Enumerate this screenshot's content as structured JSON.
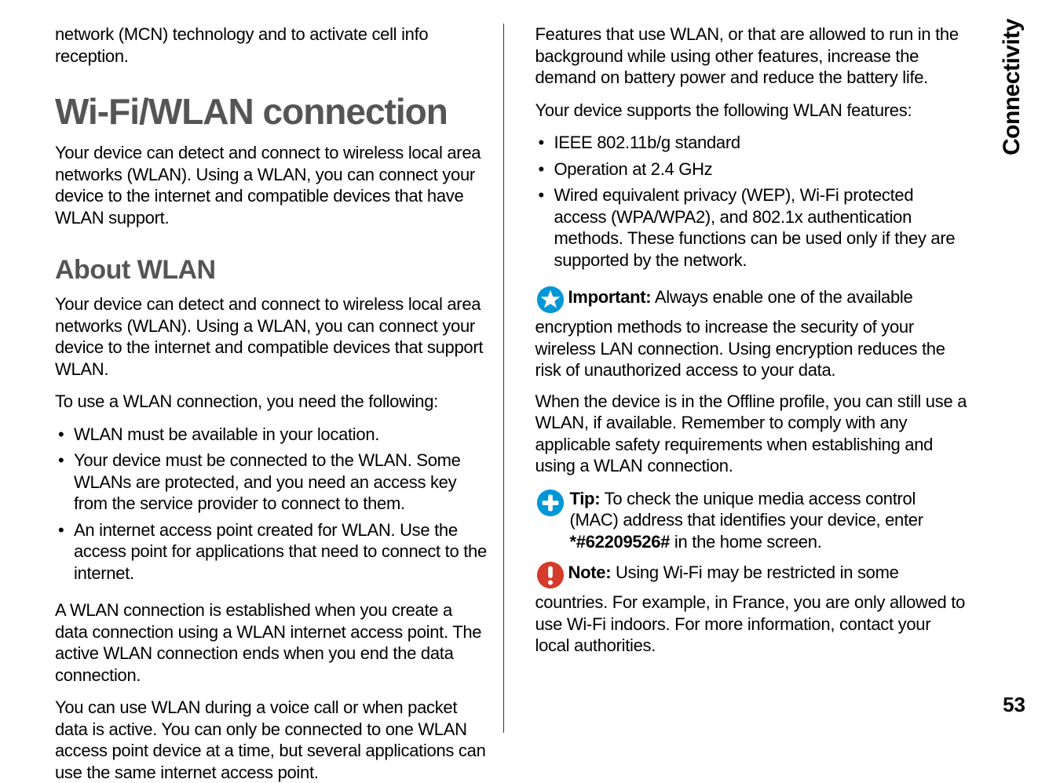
{
  "side_tab": "Connectivity",
  "page_number": "53",
  "left": {
    "intro": "network (MCN) technology and to activate cell info reception.",
    "h1": "Wi-Fi/WLAN connection",
    "p1": "Your device can detect and connect to wireless local area networks (WLAN). Using a WLAN, you can connect your device to the internet and compatible devices that have WLAN support.",
    "h2": "About WLAN",
    "p2": "Your device can detect and connect to wireless local area networks (WLAN). Using a WLAN, you can connect your device to the internet and compatible devices that support WLAN.",
    "p3": "To use a WLAN connection, you need the following:",
    "list": [
      "WLAN must be available in your location.",
      "Your device must be connected to the WLAN. Some WLANs are protected, and you need an access key from the service provider to connect to them.",
      "An internet access point created for WLAN. Use the access point for applications that need to connect to the internet."
    ],
    "p4": "A WLAN connection is established when you create a data connection using a WLAN internet access point. The active WLAN connection ends when you end the data connection.",
    "p5": "You can use WLAN during a voice call or when packet data is active. You can only be connected to one WLAN access point device at a time, but several applications can use the same internet access point."
  },
  "right": {
    "p1": "Features that use WLAN, or that are allowed to run in the background while using other features, increase the demand on battery power and reduce the battery life.",
    "p2": "Your device supports the following WLAN features:",
    "list": [
      "IEEE 802.11b/g standard",
      "Operation at 2.4 GHz",
      "Wired equivalent privacy (WEP), Wi-Fi protected access (WPA/WPA2), and 802.1x authentication methods. These functions can be used only if they are supported by the network."
    ],
    "important_label": "Important:",
    "important_body": "  Always enable one of the available encryption methods to increase the security of your wireless LAN connection. Using encryption reduces the risk of unauthorized access to your data.",
    "p3": "When the device is in the Offline profile, you can still use a WLAN, if available. Remember to comply with any applicable safety requirements when establishing and using a WLAN connection.",
    "tip_label": "Tip:",
    "tip_body": " To check the unique media access control (MAC) address that identifies your device, enter ",
    "tip_code": "*#62209526#",
    "tip_tail": " in the home screen.",
    "note_label": "Note:",
    "note_body": "  Using Wi-Fi may be restricted in some countries. For example, in France, you are only allowed to use Wi-Fi indoors. For more information, contact your local authorities."
  }
}
